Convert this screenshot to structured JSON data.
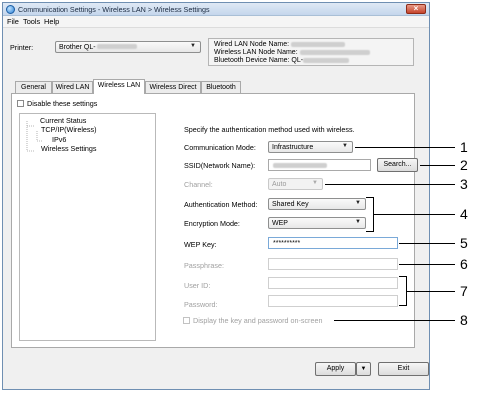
{
  "window": {
    "title": "Communication Settings - Wireless LAN > Wireless Settings",
    "close_label": "×"
  },
  "menu": [
    "File",
    "Tools",
    "Help"
  ],
  "printer": {
    "label": "Printer:",
    "value": "Brother QL-"
  },
  "info": {
    "wired_node_label": "Wired LAN Node Name:",
    "wireless_node_label": "Wireless LAN Node Name:",
    "bluetooth_label": "Bluetooth Device Name: QL-"
  },
  "tabs": [
    "General",
    "Wired LAN",
    "Wireless LAN",
    "Wireless Direct",
    "Bluetooth"
  ],
  "disable_settings_label": "Disable these settings",
  "tree": {
    "root": "Current Status",
    "tcpip": "TCP/IP(Wireless)",
    "ipv6": "IPv6",
    "wireless": "Wireless Settings"
  },
  "form": {
    "description": "Specify the authentication method used with wireless.",
    "comm_mode_label": "Communication Mode:",
    "comm_mode_value": "Infrastructure",
    "ssid_label": "SSID(Network Name):",
    "search_button": "Search...",
    "channel_label": "Channel:",
    "channel_value": "Auto",
    "auth_label": "Authentication Method:",
    "auth_value": "Shared Key",
    "enc_label": "Encryption Mode:",
    "enc_value": "WEP",
    "wep_label": "WEP Key:",
    "wep_value": "**********",
    "passphrase_label": "Passphrase:",
    "userid_label": "User ID:",
    "password_label": "Password:",
    "display_key_label": "Display the key and password on-screen"
  },
  "buttons": {
    "apply": "Apply",
    "exit": "Exit"
  },
  "callouts": [
    "1",
    "2",
    "3",
    "4",
    "5",
    "6",
    "7",
    "8"
  ],
  "colors": {
    "title_bar": "#c4d6ec",
    "close_button": "#c6442b",
    "window_border": "#6f8fb2"
  }
}
